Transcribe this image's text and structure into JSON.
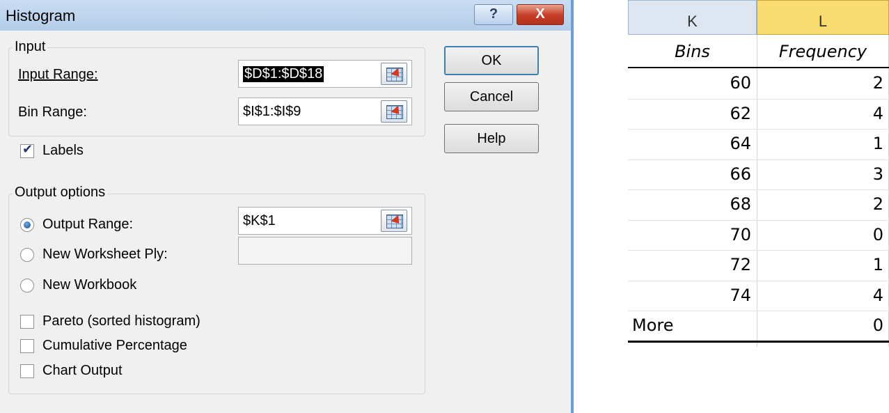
{
  "dialog": {
    "title": "Histogram",
    "help_glyph": "?",
    "close_glyph": "X",
    "input_group": {
      "title": "Input",
      "input_range_label": "Input Range:",
      "input_range_value": "$D$1:$D$18",
      "bin_range_label": "Bin Range:",
      "bin_range_value": "$I$1:$I$9"
    },
    "labels_checkbox": {
      "label": "Labels",
      "checked": true
    },
    "output_group": {
      "title": "Output options",
      "output_range_label": "Output Range:",
      "output_range_value": "$K$1",
      "new_worksheet_label": "New Worksheet Ply:",
      "new_worksheet_value": "",
      "new_workbook_label": "New Workbook",
      "selected_option": "Output Range"
    },
    "options": {
      "pareto_label": "Pareto (sorted histogram)",
      "cumulative_label": "Cumulative Percentage",
      "chart_label": "Chart Output"
    },
    "buttons": {
      "ok": "OK",
      "cancel": "Cancel",
      "help": "Help"
    },
    "icons": {
      "range_selector": "range-selector-icon"
    }
  },
  "sheet": {
    "columns": [
      "K",
      "L"
    ],
    "active_column": "L",
    "header": {
      "bins": "Bins",
      "frequency": "Frequency"
    },
    "rows": [
      {
        "bin": "60",
        "frequency": "2"
      },
      {
        "bin": "62",
        "frequency": "4"
      },
      {
        "bin": "64",
        "frequency": "1"
      },
      {
        "bin": "66",
        "frequency": "3"
      },
      {
        "bin": "68",
        "frequency": "2"
      },
      {
        "bin": "70",
        "frequency": "0"
      },
      {
        "bin": "72",
        "frequency": "1"
      },
      {
        "bin": "74",
        "frequency": "4"
      },
      {
        "bin": "More",
        "frequency": "0"
      }
    ],
    "colors": {
      "header_bg": "#dde6f1",
      "active_header_bg": "#f8dc70"
    }
  }
}
